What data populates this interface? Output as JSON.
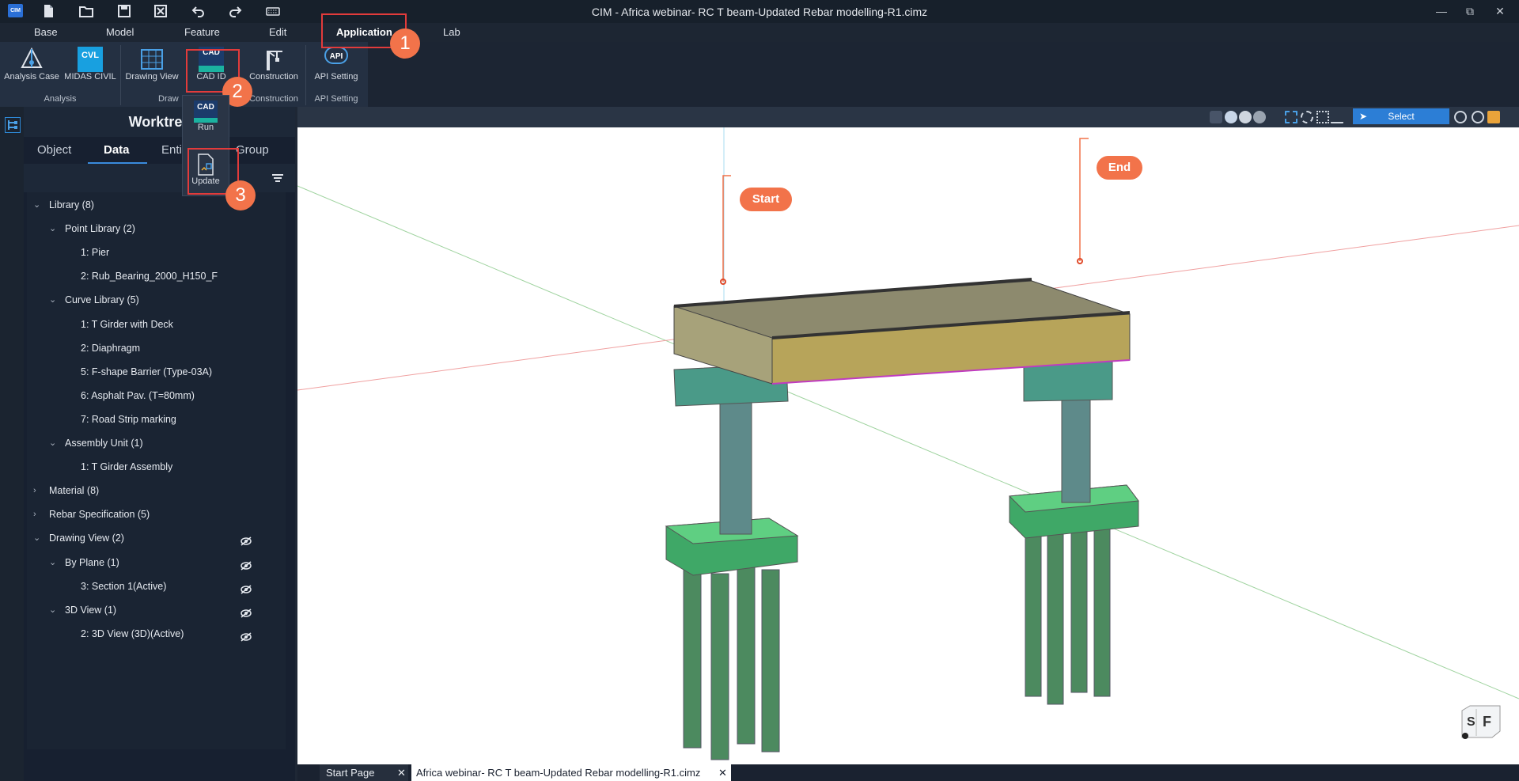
{
  "window": {
    "title": "CIM - Africa webinar- RC T beam-Updated Rebar modelling-R1.cimz",
    "app_logo": "CIM",
    "quick_access": [
      "new-file-icon",
      "open-folder-icon",
      "save-icon",
      "close-file-icon",
      "undo-icon",
      "redo-icon",
      "keyboard-icon"
    ],
    "controls": [
      "minimize-icon",
      "restore-icon",
      "close-icon"
    ]
  },
  "menu": {
    "tabs": [
      "Base",
      "Model",
      "Feature",
      "Edit",
      "Application",
      "Lab"
    ],
    "active": "Application"
  },
  "callouts": [
    "1",
    "2",
    "3"
  ],
  "ribbon": {
    "buttons": {
      "analysis_case": "Analysis Case",
      "midas_civil": "MIDAS CIVIL",
      "midas_civil_logo": "CVL",
      "drawing_view": "Drawing View",
      "cad_id": "CAD ID",
      "cad_logo": "CAD",
      "construction": "Construction",
      "api_setting": "API Setting",
      "api_logo": "API"
    },
    "groups": {
      "analysis": "Analysis",
      "drawing": "Draw",
      "construction": "Construction",
      "api_setting": "API Setting"
    }
  },
  "cad_dropdown": {
    "run": "Run",
    "update": "Update",
    "cad_logo": "CAD",
    "cad_sub": "ID"
  },
  "worktree": {
    "title": "Worktree",
    "tabs": [
      "Object",
      "Data",
      "Entity",
      "Group"
    ],
    "active_tab": "Data",
    "items": [
      {
        "label": "Library (8)",
        "level": 0,
        "expanded": true,
        "eye": false
      },
      {
        "label": "Point Library (2)",
        "level": 1,
        "expanded": true,
        "eye": false
      },
      {
        "label": "1: Pier",
        "level": 2,
        "eye": false
      },
      {
        "label": "2: Rub_Bearing_2000_H150_F",
        "level": 2,
        "eye": false
      },
      {
        "label": "Curve Library (5)",
        "level": 1,
        "expanded": true,
        "eye": false
      },
      {
        "label": "1: T Girder with Deck",
        "level": 2,
        "eye": false
      },
      {
        "label": "2: Diaphragm",
        "level": 2,
        "eye": false
      },
      {
        "label": "5: F-shape Barrier (Type-03A)",
        "level": 2,
        "eye": false
      },
      {
        "label": "6: Asphalt Pav. (T=80mm)",
        "level": 2,
        "eye": false
      },
      {
        "label": "7: Road Strip marking",
        "level": 2,
        "eye": false
      },
      {
        "label": "Assembly Unit (1)",
        "level": 1,
        "expanded": true,
        "eye": false
      },
      {
        "label": "1: T Girder Assembly",
        "level": 2,
        "eye": false
      },
      {
        "label": "Material (8)",
        "level": 0,
        "expanded": false,
        "eye": false
      },
      {
        "label": "Rebar Specification (5)",
        "level": 0,
        "expanded": false,
        "eye": false
      },
      {
        "label": "Drawing View (2)",
        "level": 0,
        "expanded": true,
        "eye": true
      },
      {
        "label": "By Plane (1)",
        "level": 1,
        "expanded": true,
        "eye": true
      },
      {
        "label": "3: Section 1(Active)",
        "level": 2,
        "eye": true
      },
      {
        "label": "3D View (1)",
        "level": 1,
        "expanded": true,
        "eye": true
      },
      {
        "label": "2: 3D View (3D)(Active)",
        "level": 2,
        "eye": true
      }
    ]
  },
  "viewport": {
    "select_label": "Select",
    "markers": {
      "start": "Start",
      "end": "End"
    },
    "view_cube": {
      "left": "S",
      "right": "F"
    }
  },
  "doc_tabs": [
    {
      "label": "Start Page",
      "active": false
    },
    {
      "label": "Africa webinar- RC T beam-Updated Rebar modelling-R1.cimz",
      "active": true
    }
  ],
  "colors": {
    "accent": "#2c7ed6",
    "callout": "#f2734a",
    "highlight_box": "#e23b3b"
  }
}
